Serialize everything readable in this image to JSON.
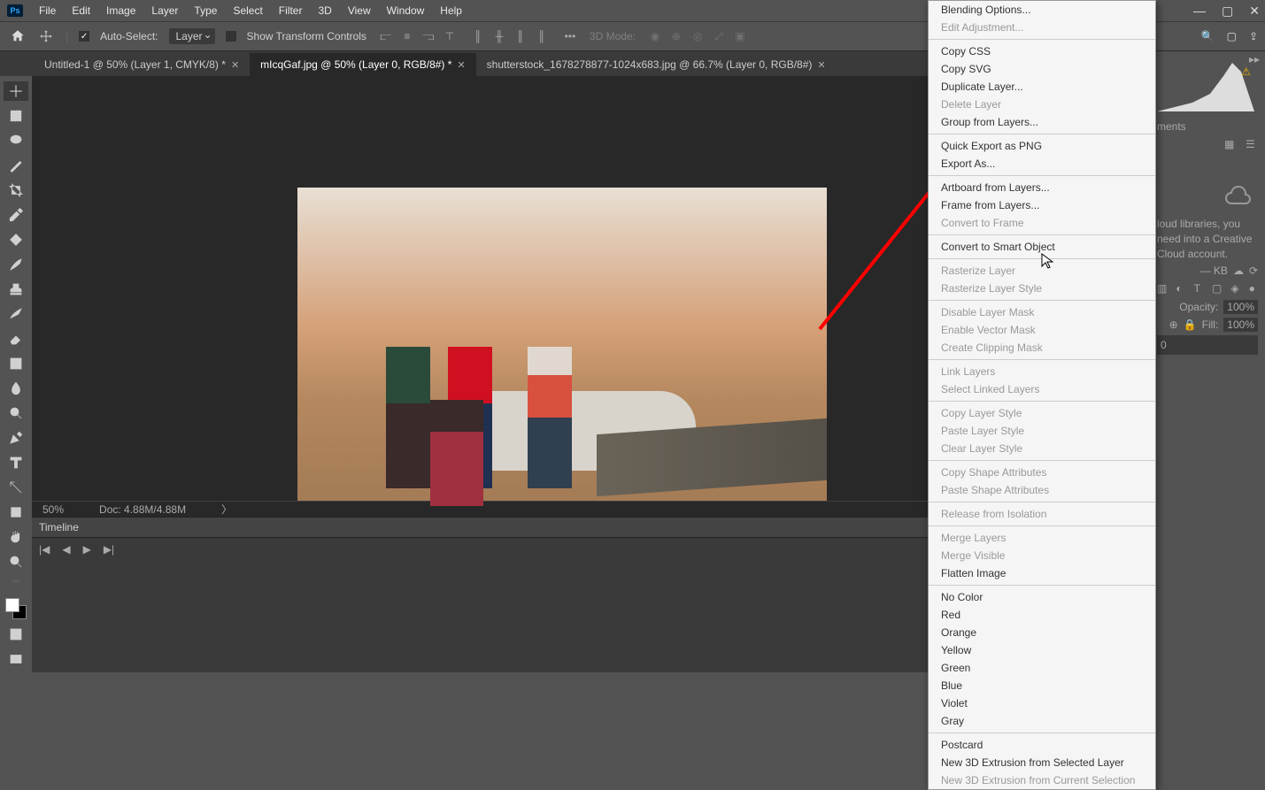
{
  "menu": {
    "items": [
      "File",
      "Edit",
      "Image",
      "Layer",
      "Type",
      "Select",
      "Filter",
      "3D",
      "View",
      "Window",
      "Help"
    ]
  },
  "options": {
    "auto_select": "Auto-Select:",
    "target": "Layer",
    "show_transform": "Show Transform Controls",
    "mode3d": "3D Mode:"
  },
  "tabs": [
    {
      "label": "Untitled-1 @ 50% (Layer 1, CMYK/8) *"
    },
    {
      "label": "mIcqGaf.jpg @ 50% (Layer 0, RGB/8#) *"
    },
    {
      "label": "shutterstock_1678278877-1024x683.jpg @ 66.7% (Layer 0, RGB/8#)"
    }
  ],
  "status": {
    "zoom": "50%",
    "doc": "Doc: 4.88M/4.88M"
  },
  "timeline": {
    "title": "Timeline"
  },
  "rightpanel": {
    "adjust_hint": "ments",
    "lib_hint": "loud libraries, you need into a Creative Cloud account.",
    "size": "— KB",
    "opacity_label": "Opacity:",
    "opacity": "100%",
    "fill_label": "Fill:",
    "fill": "100%",
    "value0": "0"
  },
  "context": {
    "groups": [
      [
        {
          "t": "Blending Options...",
          "e": true
        },
        {
          "t": "Edit Adjustment...",
          "e": false
        }
      ],
      [
        {
          "t": "Copy CSS",
          "e": true
        },
        {
          "t": "Copy SVG",
          "e": true
        },
        {
          "t": "Duplicate Layer...",
          "e": true
        },
        {
          "t": "Delete Layer",
          "e": false
        },
        {
          "t": "Group from Layers...",
          "e": true
        }
      ],
      [
        {
          "t": "Quick Export as PNG",
          "e": true
        },
        {
          "t": "Export As...",
          "e": true
        }
      ],
      [
        {
          "t": "Artboard from Layers...",
          "e": true
        },
        {
          "t": "Frame from Layers...",
          "e": true
        },
        {
          "t": "Convert to Frame",
          "e": false
        }
      ],
      [
        {
          "t": "Convert to Smart Object",
          "e": true
        }
      ],
      [
        {
          "t": "Rasterize Layer",
          "e": false
        },
        {
          "t": "Rasterize Layer Style",
          "e": false
        }
      ],
      [
        {
          "t": "Disable Layer Mask",
          "e": false
        },
        {
          "t": "Enable Vector Mask",
          "e": false
        },
        {
          "t": "Create Clipping Mask",
          "e": false
        }
      ],
      [
        {
          "t": "Link Layers",
          "e": false
        },
        {
          "t": "Select Linked Layers",
          "e": false
        }
      ],
      [
        {
          "t": "Copy Layer Style",
          "e": false
        },
        {
          "t": "Paste Layer Style",
          "e": false
        },
        {
          "t": "Clear Layer Style",
          "e": false
        }
      ],
      [
        {
          "t": "Copy Shape Attributes",
          "e": false
        },
        {
          "t": "Paste Shape Attributes",
          "e": false
        }
      ],
      [
        {
          "t": "Release from Isolation",
          "e": false
        }
      ],
      [
        {
          "t": "Merge Layers",
          "e": false
        },
        {
          "t": "Merge Visible",
          "e": false
        },
        {
          "t": "Flatten Image",
          "e": true
        }
      ],
      [
        {
          "t": "No Color",
          "e": true
        },
        {
          "t": "Red",
          "e": true
        },
        {
          "t": "Orange",
          "e": true
        },
        {
          "t": "Yellow",
          "e": true
        },
        {
          "t": "Green",
          "e": true
        },
        {
          "t": "Blue",
          "e": true
        },
        {
          "t": "Violet",
          "e": true
        },
        {
          "t": "Gray",
          "e": true
        }
      ],
      [
        {
          "t": "Postcard",
          "e": true
        },
        {
          "t": "New 3D Extrusion from Selected Layer",
          "e": true
        },
        {
          "t": "New 3D Extrusion from Current Selection",
          "e": false
        }
      ]
    ]
  }
}
